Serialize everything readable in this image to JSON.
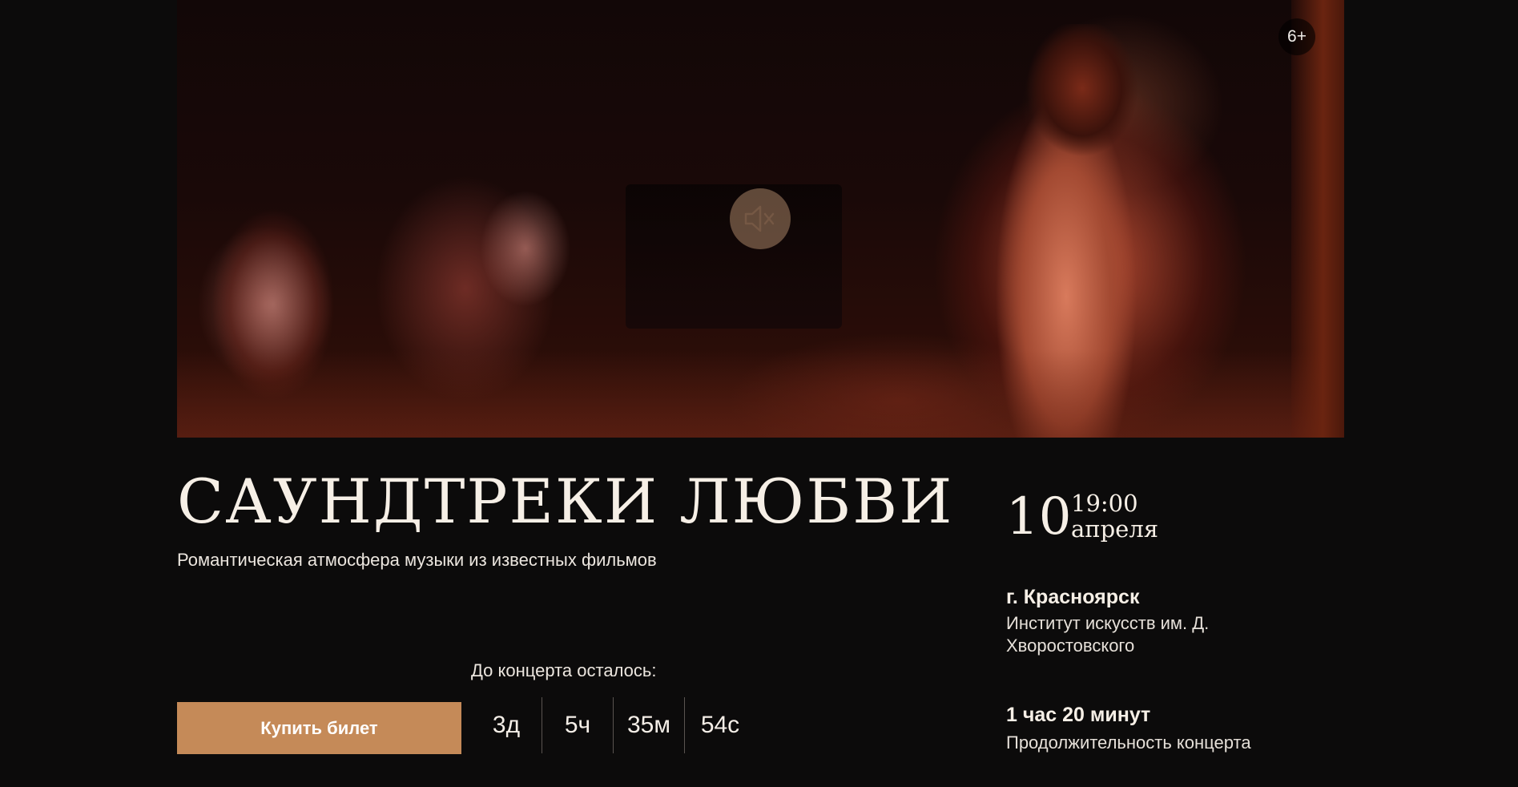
{
  "hero": {
    "age_rating": "6+",
    "mute_icon": "speaker-muted-icon"
  },
  "event": {
    "title": "САУНДТРЕКИ ЛЮБВИ",
    "subtitle": "Романтическая атмосфера музыки из известных фильмов"
  },
  "countdown": {
    "label": "До концерта осталось:",
    "days": "3д",
    "hours": "5ч",
    "minutes": "35м",
    "seconds": "54с"
  },
  "actions": {
    "buy_label": "Купить билет",
    "buy_color": "#c58a58"
  },
  "schedule": {
    "day": "10",
    "time": "19:00",
    "month": "апреля"
  },
  "location": {
    "city": "г. Красноярск",
    "venue": "Институт искусств им. Д. Хворостовского"
  },
  "duration": {
    "value": "1 час 20 минут",
    "label": "Продолжительность концерта"
  }
}
